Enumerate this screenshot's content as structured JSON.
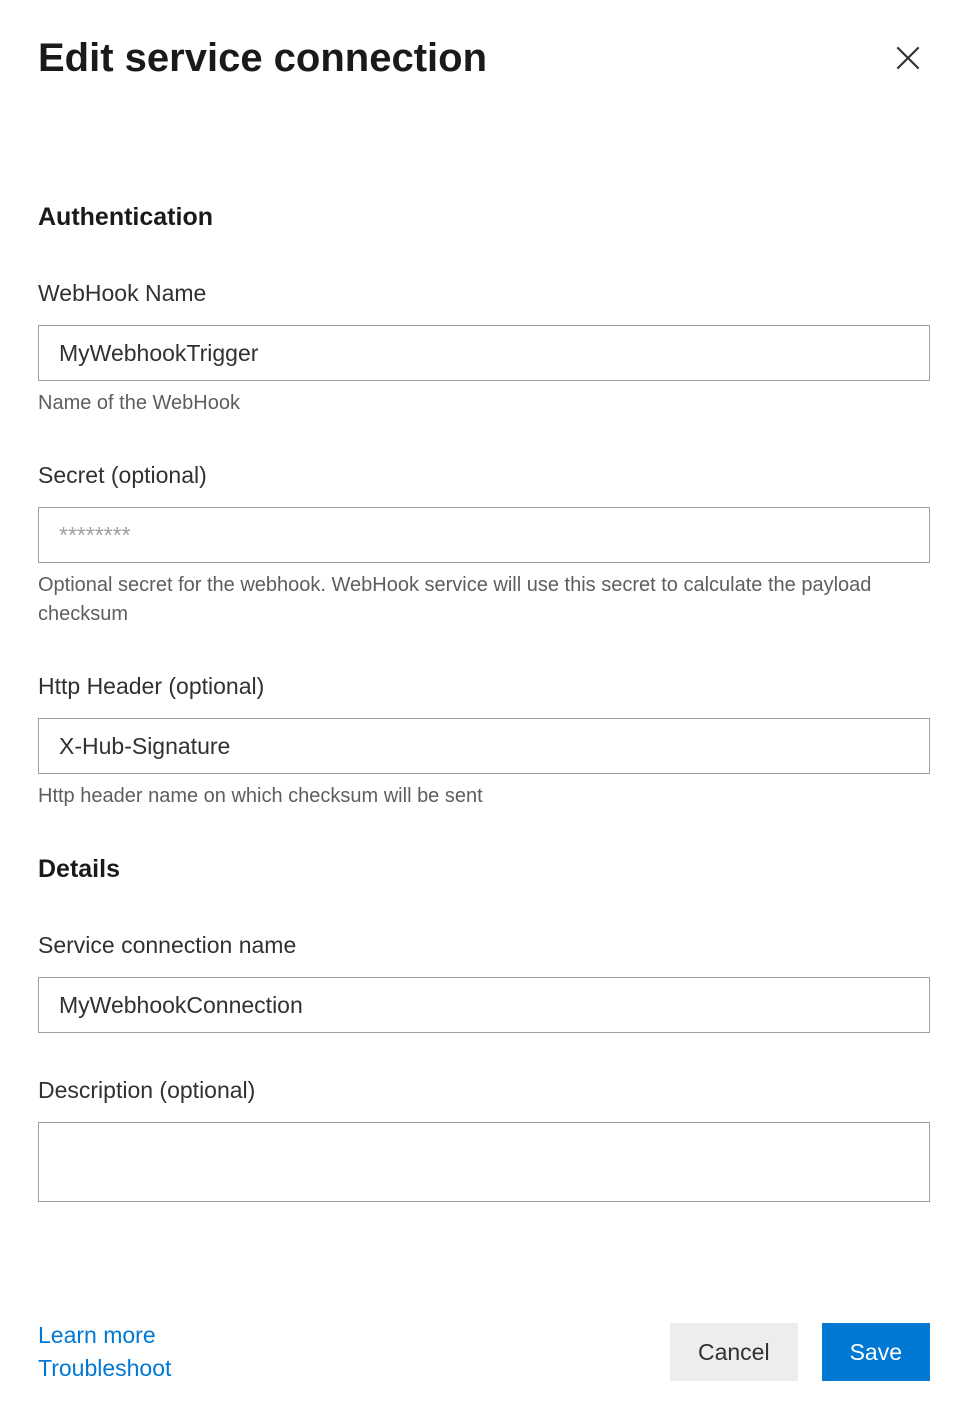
{
  "header": {
    "title": "Edit service connection"
  },
  "sections": {
    "auth": {
      "heading": "Authentication",
      "webhook_name": {
        "label": "WebHook Name",
        "value": "MyWebhookTrigger",
        "help": "Name of the WebHook"
      },
      "secret": {
        "label": "Secret (optional)",
        "placeholder": "********",
        "value": "",
        "help": "Optional secret for the webhook. WebHook service will use this secret to calculate the payload checksum"
      },
      "http_header": {
        "label": "Http Header (optional)",
        "value": "X-Hub-Signature",
        "help": "Http header name on which checksum will be sent"
      }
    },
    "details": {
      "heading": "Details",
      "connection_name": {
        "label": "Service connection name",
        "value": "MyWebhookConnection"
      },
      "description": {
        "label": "Description (optional)",
        "value": ""
      }
    }
  },
  "footer": {
    "learn_more": "Learn more",
    "troubleshoot": "Troubleshoot",
    "cancel": "Cancel",
    "save": "Save"
  }
}
